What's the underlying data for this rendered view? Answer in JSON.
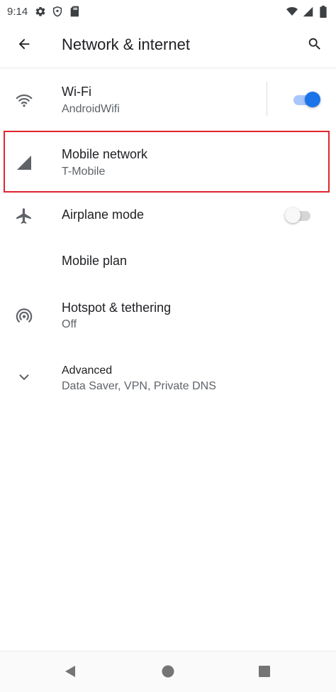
{
  "status_bar": {
    "time": "9:14",
    "left_icons": [
      "gear-icon",
      "shield-icon",
      "sd-card-icon"
    ],
    "right_icons": [
      "wifi-signal-icon",
      "cell-signal-icon",
      "battery-icon"
    ]
  },
  "app_bar": {
    "title": "Network & internet",
    "back_icon": "arrow-back-icon",
    "search_icon": "search-icon"
  },
  "settings": {
    "wifi": {
      "title": "Wi-Fi",
      "subtitle": "AndroidWifi",
      "icon": "wifi-icon",
      "enabled": true
    },
    "mobile_network": {
      "title": "Mobile network",
      "subtitle": "T-Mobile",
      "icon": "cell-signal-icon"
    },
    "airplane_mode": {
      "title": "Airplane mode",
      "icon": "airplane-icon",
      "enabled": false
    },
    "mobile_plan": {
      "title": "Mobile plan"
    },
    "hotspot": {
      "title": "Hotspot & tethering",
      "subtitle": "Off",
      "icon": "hotspot-icon"
    },
    "advanced": {
      "title": "Advanced",
      "subtitle": "Data Saver, VPN, Private DNS",
      "icon": "chevron-down-icon"
    }
  },
  "nav_bar": {
    "icons": [
      "back-triangle-icon",
      "home-circle-icon",
      "recents-square-icon"
    ]
  },
  "colors": {
    "accent": "#1a73e8",
    "highlight": "#e0242f",
    "text_primary": "#202124",
    "text_secondary": "#5f6368",
    "icon": "#5f6368"
  }
}
